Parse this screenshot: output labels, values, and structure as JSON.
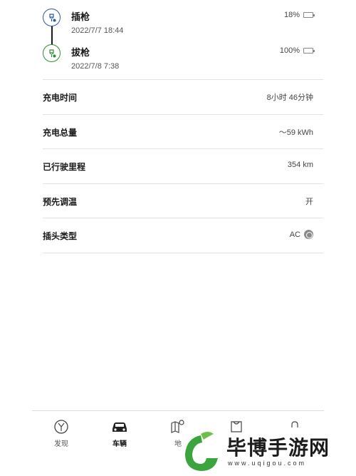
{
  "timeline": {
    "events": [
      {
        "title": "插枪",
        "time": "2022/7/7 18:44",
        "level": "18%",
        "icon": "plug-in-icon"
      },
      {
        "title": "拔枪",
        "time": "2022/7/8 7:38",
        "level": "100%",
        "icon": "plug-out-icon"
      }
    ]
  },
  "details": [
    {
      "label": "充电时间",
      "value": "8小时 46分钟"
    },
    {
      "label": "充电总量",
      "value": "～59 kWh"
    },
    {
      "label": "已行驶里程",
      "value": "354 km"
    },
    {
      "label": "预先调温",
      "value": "开"
    },
    {
      "label": "插头类型",
      "value": "AC"
    }
  ],
  "tabs": [
    {
      "label": "发现",
      "icon": "discover-icon",
      "active": false
    },
    {
      "label": "车辆",
      "icon": "car-icon",
      "active": true
    },
    {
      "label": "地",
      "icon": "map-icon",
      "active": false
    },
    {
      "label": "",
      "icon": "shop-icon",
      "active": false
    },
    {
      "label": "",
      "icon": "profile-icon",
      "active": false
    }
  ],
  "watermark": {
    "text": "毕博手游网",
    "url": "www.uqigou.com"
  },
  "colors": {
    "plug_in": "#2f56a6",
    "plug_out": "#2f8a3a",
    "divider": "#e3e3e3",
    "watermark_green": "#3aa53c"
  }
}
